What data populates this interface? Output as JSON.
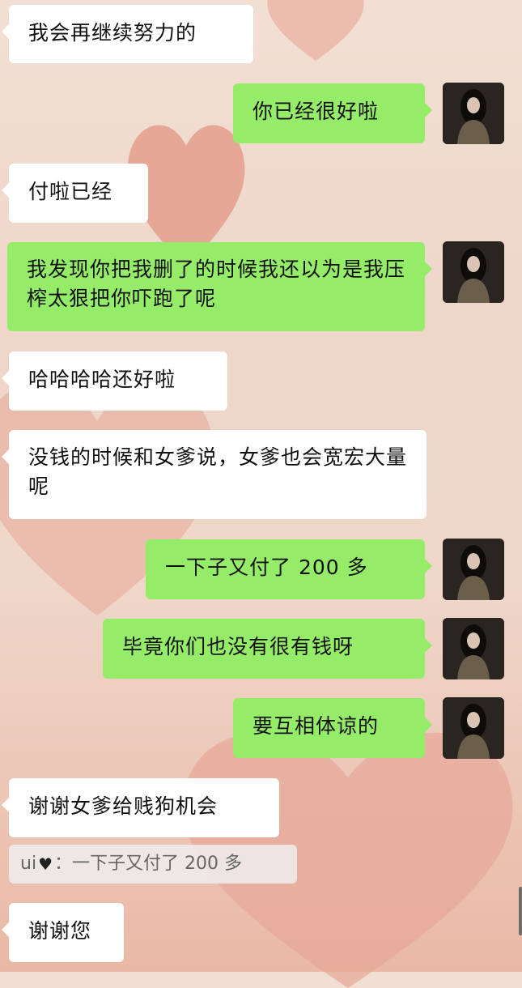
{
  "messages": [
    {
      "side": "in",
      "text": "我会再继续努力的"
    },
    {
      "side": "out",
      "text": "你已经很好啦"
    },
    {
      "side": "in",
      "text": "付啦已经"
    },
    {
      "side": "out",
      "text": "我发现你把我删了的时候我还以为是我压榨太狠把你吓跑了呢"
    },
    {
      "side": "in",
      "text": "哈哈哈哈还好啦"
    },
    {
      "side": "in",
      "text": "没钱的时候和女爹说，女爹也会宽宏大量呢"
    },
    {
      "side": "out",
      "text": "一下子又付了 200 多"
    },
    {
      "side": "out",
      "text": "毕竟你们也没有很有钱呀"
    },
    {
      "side": "out",
      "text": "要互相体谅的"
    },
    {
      "side": "in",
      "text": "谢谢女爹给贱狗机会"
    },
    {
      "side": "in",
      "text": "谢谢您"
    }
  ],
  "quote": {
    "sender": "ui",
    "separator": "：",
    "text": "一下子又付了 200 多"
  },
  "colors": {
    "outgoing_bubble": "#95ec69",
    "incoming_bubble": "#ffffff",
    "background_heart": "#e7a797"
  }
}
